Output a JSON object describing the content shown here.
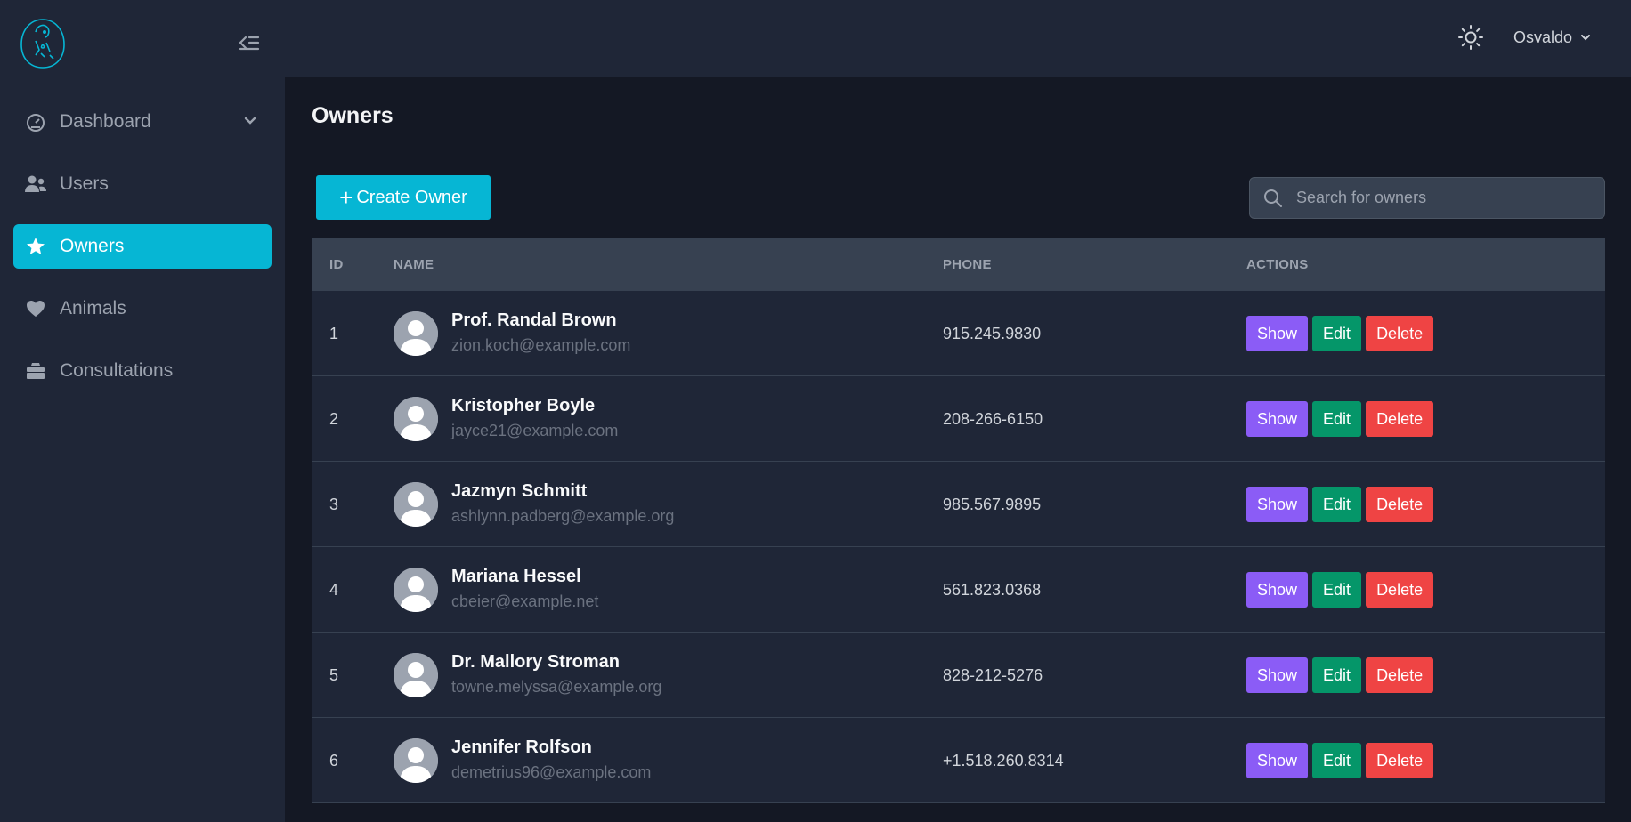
{
  "sidebar": {
    "items": [
      {
        "label": "Dashboard",
        "icon": "gauge-icon"
      },
      {
        "label": "Users",
        "icon": "users-icon"
      },
      {
        "label": "Owners",
        "icon": "star-icon"
      },
      {
        "label": "Animals",
        "icon": "heart-icon"
      },
      {
        "label": "Consultations",
        "icon": "briefcase-icon"
      }
    ],
    "active": "Owners"
  },
  "header": {
    "user_name": "Osvaldo"
  },
  "main": {
    "title": "Owners",
    "create_label": "Create Owner",
    "search_placeholder": "Search for owners"
  },
  "table": {
    "columns": [
      "ID",
      "NAME",
      "PHONE",
      "ACTIONS"
    ],
    "action_labels": {
      "show": "Show",
      "edit": "Edit",
      "delete": "Delete"
    },
    "rows": [
      {
        "id": "1",
        "name": "Prof. Randal Brown",
        "email": "zion.koch@example.com",
        "phone": "915.245.9830"
      },
      {
        "id": "2",
        "name": "Kristopher Boyle",
        "email": "jayce21@example.com",
        "phone": "208-266-6150"
      },
      {
        "id": "3",
        "name": "Jazmyn Schmitt",
        "email": "ashlynn.padberg@example.org",
        "phone": "985.567.9895"
      },
      {
        "id": "4",
        "name": "Mariana Hessel",
        "email": "cbeier@example.net",
        "phone": "561.823.0368"
      },
      {
        "id": "5",
        "name": "Dr. Mallory Stroman",
        "email": "towne.melyssa@example.org",
        "phone": "828-212-5276"
      },
      {
        "id": "6",
        "name": "Jennifer Rolfson",
        "email": "demetrius96@example.com",
        "phone": "+1.518.260.8314"
      }
    ]
  },
  "colors": {
    "accent": "#06b6d4",
    "sidebar_bg": "#1f2637",
    "page_bg": "#141824",
    "show": "#8b5cf6",
    "edit": "#059669",
    "delete": "#ef4444"
  }
}
